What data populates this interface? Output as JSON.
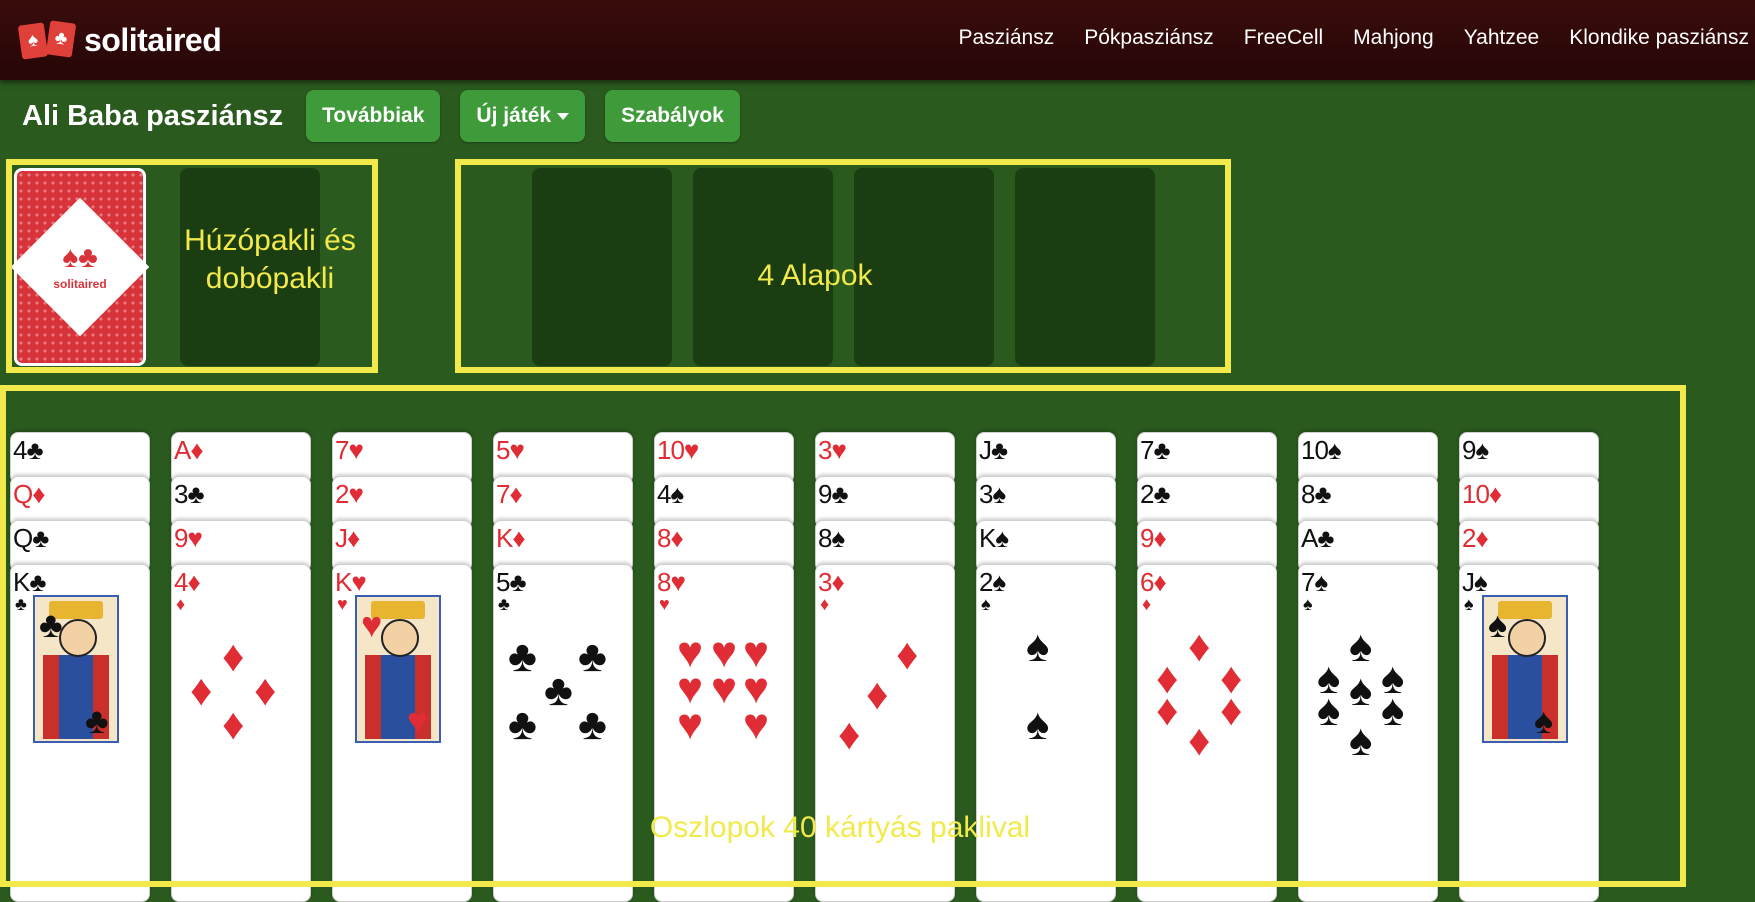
{
  "header": {
    "logo_text": "solitaired",
    "nav": [
      "Pasziánsz",
      "Pókpasziánsz",
      "FreeCell",
      "Mahjong",
      "Yahtzee",
      "Klondike pasziánsz"
    ]
  },
  "toolbar": {
    "title": "Ali Baba pasziánsz",
    "more_label": "Továbbiak",
    "new_game_label": "Új játék",
    "rules_label": "Szabályok"
  },
  "regions": {
    "stock_label_line1": "Húzópakli és",
    "stock_label_line2": "dobópakli",
    "foundations_label": "4 Alapok",
    "tableau_label": "Oszlopok 40 kártyás paklival"
  },
  "card_back_text": "solitaired",
  "tableau": [
    [
      {
        "rank": "4",
        "suit": "♣"
      },
      {
        "rank": "Q",
        "suit": "♦"
      },
      {
        "rank": "Q",
        "suit": "♣"
      },
      {
        "rank": "K",
        "suit": "♣"
      }
    ],
    [
      {
        "rank": "A",
        "suit": "♦"
      },
      {
        "rank": "3",
        "suit": "♣"
      },
      {
        "rank": "9",
        "suit": "♥"
      },
      {
        "rank": "4",
        "suit": "♦"
      }
    ],
    [
      {
        "rank": "7",
        "suit": "♥"
      },
      {
        "rank": "2",
        "suit": "♥"
      },
      {
        "rank": "J",
        "suit": "♦"
      },
      {
        "rank": "K",
        "suit": "♥"
      }
    ],
    [
      {
        "rank": "5",
        "suit": "♥"
      },
      {
        "rank": "7",
        "suit": "♦"
      },
      {
        "rank": "K",
        "suit": "♦"
      },
      {
        "rank": "5",
        "suit": "♣"
      }
    ],
    [
      {
        "rank": "10",
        "suit": "♥"
      },
      {
        "rank": "4",
        "suit": "♠"
      },
      {
        "rank": "8",
        "suit": "♦"
      },
      {
        "rank": "8",
        "suit": "♥"
      }
    ],
    [
      {
        "rank": "3",
        "suit": "♥"
      },
      {
        "rank": "9",
        "suit": "♣"
      },
      {
        "rank": "8",
        "suit": "♠"
      },
      {
        "rank": "3",
        "suit": "♦"
      }
    ],
    [
      {
        "rank": "J",
        "suit": "♣"
      },
      {
        "rank": "3",
        "suit": "♠"
      },
      {
        "rank": "K",
        "suit": "♠"
      },
      {
        "rank": "2",
        "suit": "♠"
      }
    ],
    [
      {
        "rank": "7",
        "suit": "♣"
      },
      {
        "rank": "2",
        "suit": "♣"
      },
      {
        "rank": "9",
        "suit": "♦"
      },
      {
        "rank": "6",
        "suit": "♦"
      }
    ],
    [
      {
        "rank": "10",
        "suit": "♠"
      },
      {
        "rank": "8",
        "suit": "♣"
      },
      {
        "rank": "A",
        "suit": "♣"
      },
      {
        "rank": "7",
        "suit": "♠"
      }
    ],
    [
      {
        "rank": "9",
        "suit": "♠"
      },
      {
        "rank": "10",
        "suit": "♦"
      },
      {
        "rank": "2",
        "suit": "♦"
      },
      {
        "rank": "J",
        "suit": "♠"
      }
    ]
  ]
}
